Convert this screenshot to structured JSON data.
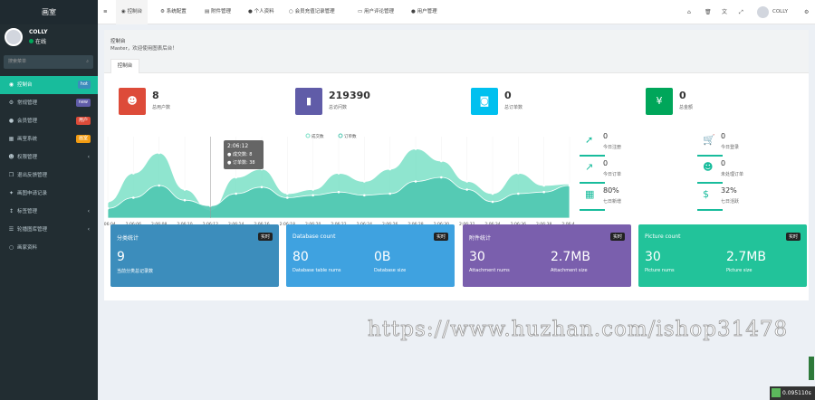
{
  "sidebar": {
    "logo": "画室",
    "user_name": "COLLY",
    "user_status": "在线",
    "search_placeholder": "搜索菜单",
    "items": [
      {
        "label": "控制台",
        "icon": "dashboard-icon",
        "badge": "hot",
        "badge_color": "#3c8dbc",
        "active": true
      },
      {
        "label": "常规管理",
        "icon": "cogs-icon",
        "badge": "new",
        "badge_color": "#605ca8"
      },
      {
        "label": "会员管理",
        "icon": "user-icon",
        "badge": "用户",
        "badge_color": "#dd4b39"
      },
      {
        "label": "画室系统",
        "icon": "table-icon",
        "badge": "画室",
        "badge_color": "#f39c12"
      },
      {
        "label": "权限管理",
        "icon": "users-icon",
        "arrow": "‹"
      },
      {
        "label": "退出反馈管理",
        "icon": "clone-icon"
      },
      {
        "label": "画图申请记录",
        "icon": "wand-icon"
      },
      {
        "label": "标签管理",
        "icon": "sort-icon",
        "arrow": "‹"
      },
      {
        "label": "轮播图库管理",
        "icon": "list-icon",
        "arrow": "‹"
      },
      {
        "label": "画家资料",
        "icon": "circle-icon"
      }
    ]
  },
  "topbar": {
    "tabs": [
      {
        "label": "控制台",
        "icon": "dashboard-icon",
        "active": true
      },
      {
        "label": "系统配置",
        "icon": "cog-icon"
      },
      {
        "label": "附件管理",
        "icon": "file-icon"
      },
      {
        "label": "个人资料",
        "icon": "user-icon"
      },
      {
        "label": "会员充值记录管理",
        "icon": "circle-icon"
      },
      {
        "label": "用户评论管理",
        "icon": "comment-icon"
      },
      {
        "label": "用户管理",
        "icon": "user-icon"
      }
    ],
    "user_name": "COLLY"
  },
  "header": {
    "title": "控制台",
    "subtitle": "Master，欢迎使用图表后台！",
    "tab": "控制台"
  },
  "stats": [
    {
      "value": "8",
      "label": "总用户数",
      "color": "#dd4b39"
    },
    {
      "value": "219390",
      "label": "总访问数",
      "color": "#605ca8"
    },
    {
      "value": "0",
      "label": "总订单数",
      "color": "#00c0ef"
    },
    {
      "value": "0",
      "label": "总金额",
      "color": "#00a65a"
    }
  ],
  "side_stats": [
    {
      "value": "0",
      "label": "今日注册",
      "color": "#18bc9c"
    },
    {
      "value": "0",
      "label": "今日登录",
      "color": "#18bc9c"
    },
    {
      "value": "0",
      "label": "今日订单",
      "color": "#18bc9c"
    },
    {
      "value": "0",
      "label": "未处理订单",
      "color": "#18bc9c"
    },
    {
      "value": "80%",
      "label": "七日新增",
      "color": "#18bc9c"
    },
    {
      "value": "32%",
      "label": "七日活跃",
      "color": "#18bc9c"
    }
  ],
  "chart_data": {
    "type": "area",
    "legend": [
      "成交数",
      "订单数"
    ],
    "x": [
      "2:06:04",
      "2:06:06",
      "2:06:08",
      "2:06:10",
      "2:06:12",
      "2:06:14",
      "2:06:16",
      "2:06:18",
      "2:06:20",
      "2:06:22",
      "2:06:24",
      "2:06:26",
      "2:06:28",
      "2:06:30",
      "2:06:32",
      "2:06:34",
      "2:06:36",
      "2:06:38",
      "2:06:40"
    ],
    "series": [
      {
        "name": "成交数",
        "color": "#7be0c7",
        "values": [
          20,
          55,
          80,
          35,
          10,
          50,
          60,
          30,
          35,
          55,
          45,
          60,
          85,
          70,
          45,
          30,
          55,
          40,
          42
        ]
      },
      {
        "name": "订单数",
        "color": "#4fc6b0",
        "values": [
          12,
          25,
          40,
          22,
          15,
          30,
          38,
          25,
          28,
          32,
          28,
          30,
          45,
          50,
          35,
          20,
          30,
          32,
          40
        ]
      }
    ],
    "tooltip": {
      "time": "2:06:12",
      "row1": "成交数: 8",
      "row2": "订单数: 38"
    },
    "ylim": [
      0,
      100
    ]
  },
  "cards": [
    {
      "title": "分类统计",
      "tag": "实时",
      "v1": "9",
      "s1": "当前分类总记录数",
      "v2": "",
      "s2": "",
      "color": "#3c8dbc"
    },
    {
      "title": "Database count",
      "tag": "实时",
      "v1": "80",
      "s1": "Database table nums",
      "v2": "0B",
      "s2": "Database size",
      "color": "#3fa2e0"
    },
    {
      "title": "附件统计",
      "tag": "实时",
      "v1": "30",
      "s1": "Attachment nums",
      "v2": "2.7MB",
      "s2": "Attachment size",
      "color": "#7a5fad"
    },
    {
      "title": "Picture count",
      "tag": "实时",
      "v1": "30",
      "s1": "Picture nums",
      "v2": "2.7MB",
      "s2": "Picture size",
      "color": "#22c39a"
    }
  ],
  "watermark": "https://www.huzhan.com/ishop31478",
  "bottom_badge": "0.095110s"
}
